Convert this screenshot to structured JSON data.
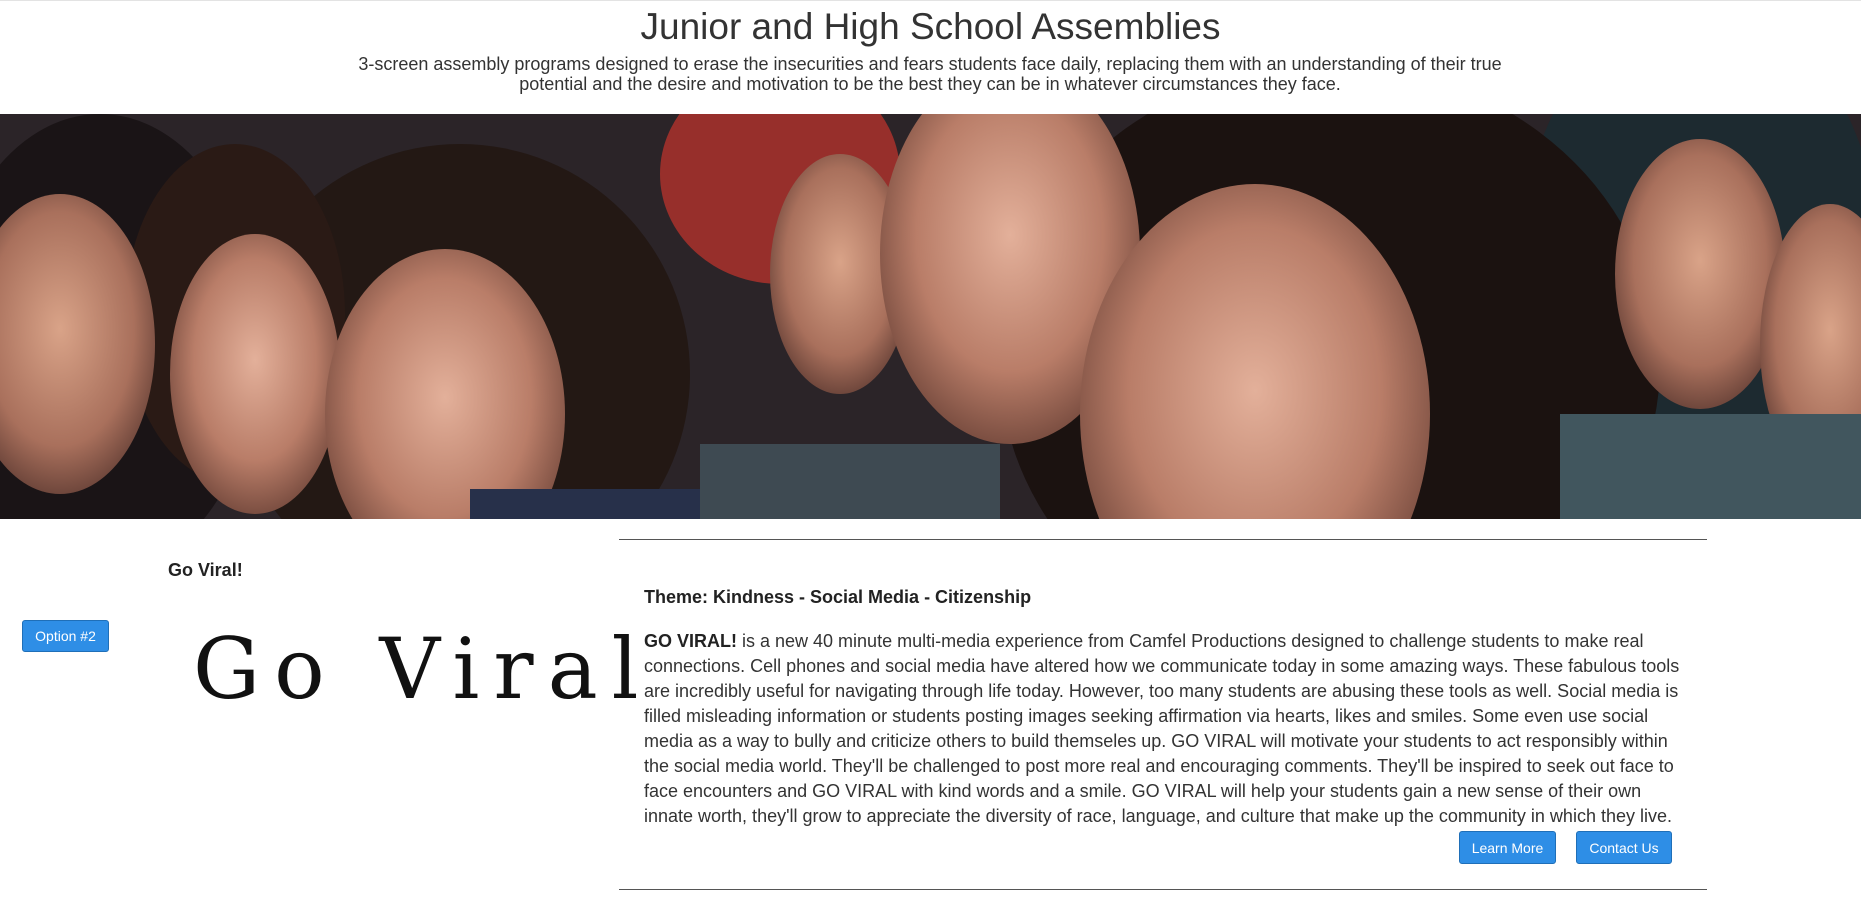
{
  "header": {
    "title": "Junior and High School Assemblies",
    "subtitle": "3-screen assembly programs designed to erase the insecurities and fears students face daily, replacing them with an understanding of their true potential and the desire and motivation to be the best they can be in whatever circumstances they face."
  },
  "hero": {
    "image": "smiling-students-in-assembly-photo"
  },
  "program": {
    "name": "Go Viral!",
    "option_label": "Option #2",
    "logo_text": "Go Viral",
    "theme": "Theme: Kindness - Social Media - Citizenship",
    "lead": "GO VIRAL!",
    "description": " is a new 40 minute multi-media experience from Camfel Productions designed to challenge students to make real connections. Cell phones and social media have altered how we communicate today in some amazing ways. These fabulous tools are incredibly useful for navigating through life today. However, too many students are abusing these tools as well. Social media is filled misleading information or students posting images seeking affirmation via hearts, likes and smiles. Some even use social media as a way to bully and criticize others to build themseles up. GO VIRAL will motivate your students to act responsibly within the social media world. They'll be challenged to post more real and encouraging comments. They'll be inspired to seek out face to face encounters and GO VIRAL with kind words and a smile. GO VIRAL will help your students gain a new sense of their own innate worth, they'll grow to appreciate the diversity of race, language, and culture that make up the community in which they live.",
    "learn_more_label": "Learn More",
    "contact_label": "Contact Us"
  },
  "colors": {
    "button": "#2e8ee6",
    "text": "#333333"
  }
}
